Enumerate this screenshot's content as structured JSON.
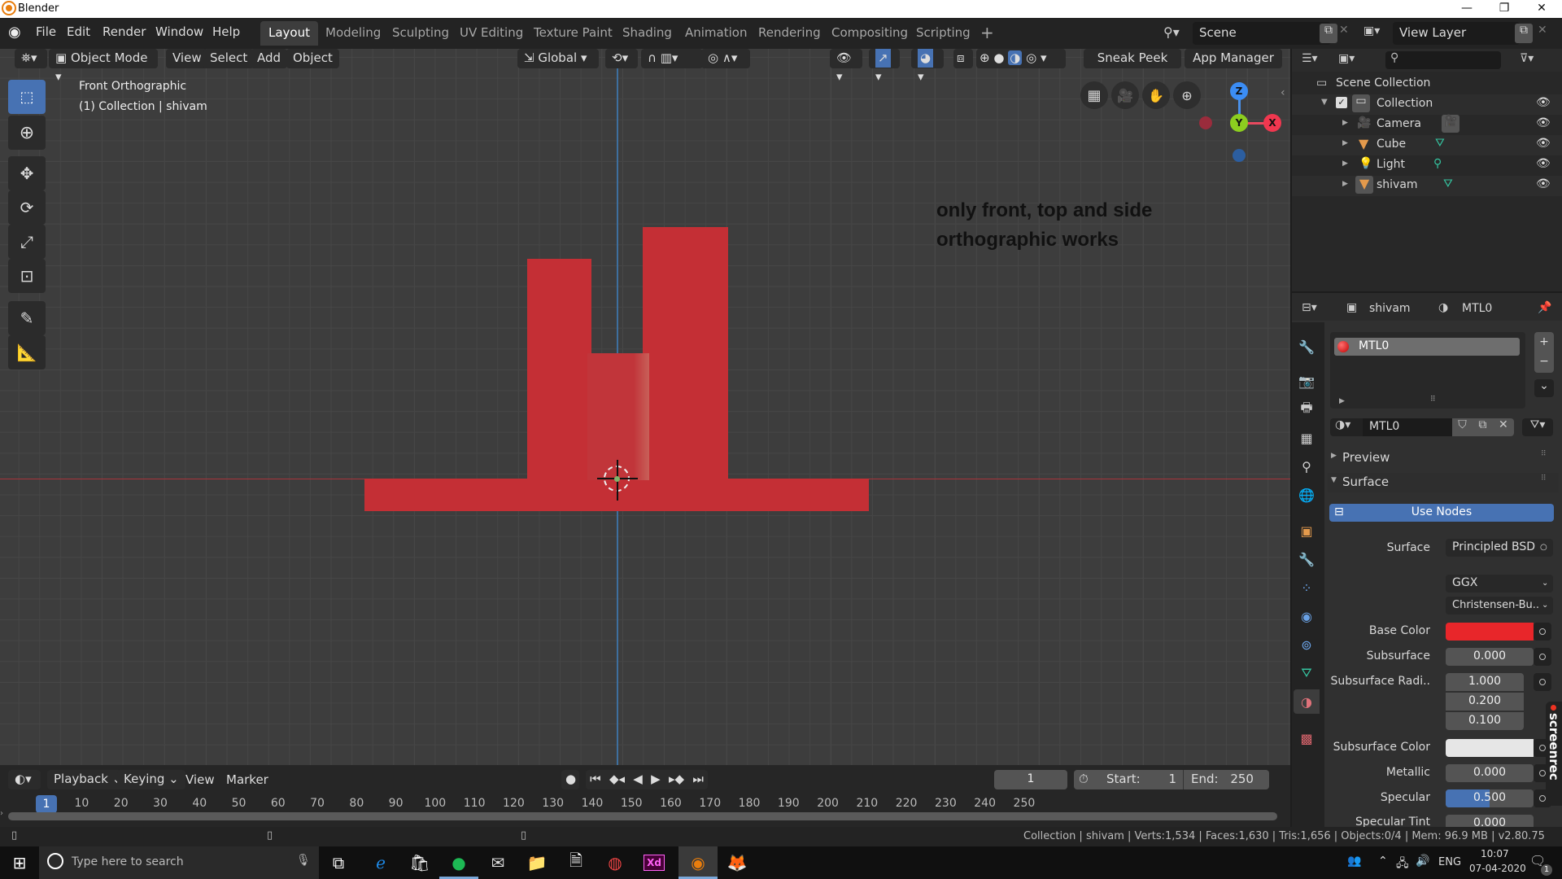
{
  "window": {
    "title": "Blender",
    "minimize": "—",
    "maximize": "❐",
    "close": "✕"
  },
  "menubar": {
    "items": [
      "File",
      "Edit",
      "Render",
      "Window",
      "Help"
    ]
  },
  "workspaces": {
    "tabs": [
      "Layout",
      "Modeling",
      "Sculpting",
      "UV Editing",
      "Texture Paint",
      "Shading",
      "Animation",
      "Rendering",
      "Compositing",
      "Scripting"
    ],
    "active": "Layout",
    "add": "+"
  },
  "scene": {
    "name": "Scene",
    "view_layer": "View Layer"
  },
  "viewport_header": {
    "mode": "Object Mode",
    "menus": [
      "View",
      "Select",
      "Add",
      "Object"
    ],
    "orientation": "Global",
    "buttons": [
      "Sneak Peek",
      "App Manager"
    ]
  },
  "viewport": {
    "view_name": "Front Orthographic",
    "collection_info": "(1) Collection | shivam",
    "annotation_line1": "only front, top and side",
    "annotation_line2": "orthographic works",
    "gizmo": {
      "z": "Z",
      "y": "Y",
      "x": "X"
    },
    "object_color": "#c42f35"
  },
  "outliner": {
    "search_placeholder": "",
    "root": "Scene Collection",
    "collection": "Collection",
    "objects": [
      {
        "name": "Camera",
        "type": "camera"
      },
      {
        "name": "Cube",
        "type": "mesh"
      },
      {
        "name": "Light",
        "type": "light"
      },
      {
        "name": "shivam",
        "type": "mesh"
      }
    ]
  },
  "properties": {
    "object": "shivam",
    "material": "MTL0",
    "slots": [
      "MTL0"
    ],
    "material_name": "MTL0",
    "sections": {
      "preview": "Preview",
      "surface": "Surface"
    },
    "use_nodes": "Use Nodes",
    "surface_label": "Surface",
    "surface_value": "Principled BSD",
    "distribution": "GGX",
    "subsurface_method": "Christensen-Bu..",
    "fields": [
      {
        "label": "Base Color",
        "type": "color",
        "value": "#e8262a"
      },
      {
        "label": "Subsurface",
        "value": "0.000"
      },
      {
        "label": "Subsurface Radi..",
        "values": [
          "1.000",
          "0.200",
          "0.100"
        ]
      },
      {
        "label": "Subsurface Color",
        "type": "color",
        "value": "#e6e6e6"
      },
      {
        "label": "Metallic",
        "value": "0.000"
      },
      {
        "label": "Specular",
        "value": "0.500",
        "fill": 0.5
      },
      {
        "label": "Specular Tint",
        "value": "0.000"
      }
    ]
  },
  "timeline": {
    "menus": [
      "Playback",
      "Keying",
      "View",
      "Marker"
    ],
    "current_frame": "1",
    "start_label": "Start:",
    "start": "1",
    "end_label": "End:",
    "end": "250",
    "ticks": [
      "1",
      "10",
      "20",
      "30",
      "40",
      "50",
      "60",
      "70",
      "80",
      "90",
      "100",
      "110",
      "120",
      "130",
      "140",
      "150",
      "160",
      "170",
      "180",
      "190",
      "200",
      "210",
      "220",
      "230",
      "240",
      "250"
    ]
  },
  "statusbar": {
    "text": "Collection | shivam | Verts:1,534 | Faces:1,630 | Tris:1,656 | Objects:0/4 | Mem: 96.9 MB | v2.80.75"
  },
  "overlay": {
    "screenrec": "screenrec"
  },
  "taskbar": {
    "search_placeholder": "Type here to search",
    "lang": "ENG",
    "time": "10:07",
    "date": "07-04-2020",
    "notifications": "1"
  }
}
